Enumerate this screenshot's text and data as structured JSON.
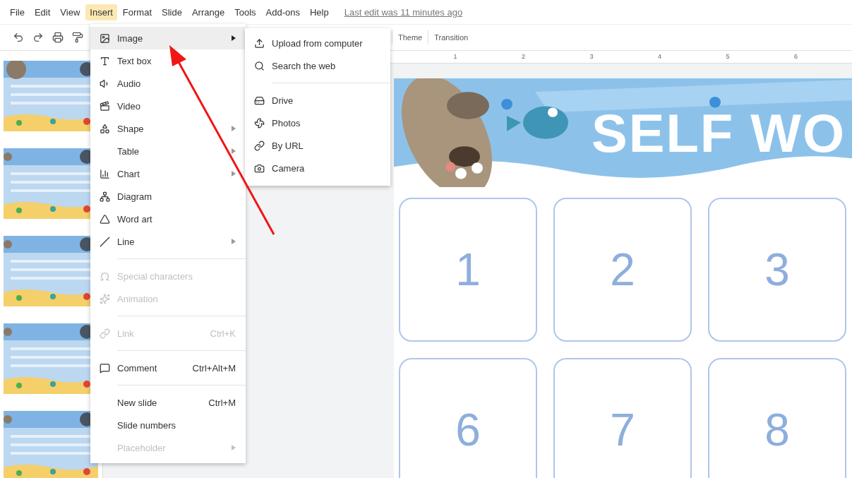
{
  "menubar": {
    "items": [
      {
        "label": "File",
        "selected": false
      },
      {
        "label": "Edit",
        "selected": false
      },
      {
        "label": "View",
        "selected": false
      },
      {
        "label": "Insert",
        "selected": true
      },
      {
        "label": "Format",
        "selected": false
      },
      {
        "label": "Slide",
        "selected": false
      },
      {
        "label": "Arrange",
        "selected": false
      },
      {
        "label": "Tools",
        "selected": false
      },
      {
        "label": "Add-ons",
        "selected": false
      },
      {
        "label": "Help",
        "selected": false
      }
    ],
    "last_edit": "Last edit was 11 minutes ago"
  },
  "toolbar": {
    "buttons": [
      "Theme",
      "Transition"
    ]
  },
  "ruler": {
    "marks": [
      "1",
      "2",
      "3",
      "4",
      "5",
      "6"
    ]
  },
  "slide": {
    "title": "SELF WO",
    "cards": [
      "1",
      "2",
      "3",
      "6",
      "7",
      "8"
    ]
  },
  "insert_menu": {
    "groups": [
      [
        {
          "label": "Image",
          "highlighted": true,
          "disabled": false,
          "submenu": true
        },
        {
          "label": "Text box",
          "highlighted": false,
          "disabled": false,
          "submenu": false
        },
        {
          "label": "Audio",
          "highlighted": false,
          "disabled": false,
          "submenu": false
        },
        {
          "label": "Video",
          "highlighted": false,
          "disabled": false,
          "submenu": false
        },
        {
          "label": "Shape",
          "highlighted": false,
          "disabled": false,
          "submenu": true
        },
        {
          "label": "Table",
          "highlighted": false,
          "disabled": false,
          "submenu": true
        },
        {
          "label": "Chart",
          "highlighted": false,
          "disabled": false,
          "submenu": true
        },
        {
          "label": "Diagram",
          "highlighted": false,
          "disabled": false,
          "submenu": false
        },
        {
          "label": "Word art",
          "highlighted": false,
          "disabled": false,
          "submenu": false
        },
        {
          "label": "Line",
          "highlighted": false,
          "disabled": false,
          "submenu": true
        }
      ],
      [
        {
          "label": "Special characters",
          "highlighted": false,
          "disabled": true,
          "submenu": false
        },
        {
          "label": "Animation",
          "highlighted": false,
          "disabled": true,
          "submenu": false
        }
      ],
      [
        {
          "label": "Link",
          "shortcut": "Ctrl+K",
          "highlighted": false,
          "disabled": true,
          "submenu": false
        }
      ],
      [
        {
          "label": "Comment",
          "shortcut": "Ctrl+Alt+M",
          "highlighted": false,
          "disabled": false,
          "submenu": false
        }
      ],
      [
        {
          "label": "New slide",
          "shortcut": "Ctrl+M",
          "highlighted": false,
          "disabled": false,
          "submenu": false
        },
        {
          "label": "Slide numbers",
          "highlighted": false,
          "disabled": false,
          "submenu": false
        },
        {
          "label": "Placeholder",
          "highlighted": false,
          "disabled": true,
          "submenu": true
        }
      ]
    ]
  },
  "image_submenu": {
    "groups": [
      [
        {
          "label": "Upload from computer"
        },
        {
          "label": "Search the web"
        }
      ],
      [
        {
          "label": "Drive"
        },
        {
          "label": "Photos"
        },
        {
          "label": "By URL"
        },
        {
          "label": "Camera"
        }
      ]
    ]
  }
}
